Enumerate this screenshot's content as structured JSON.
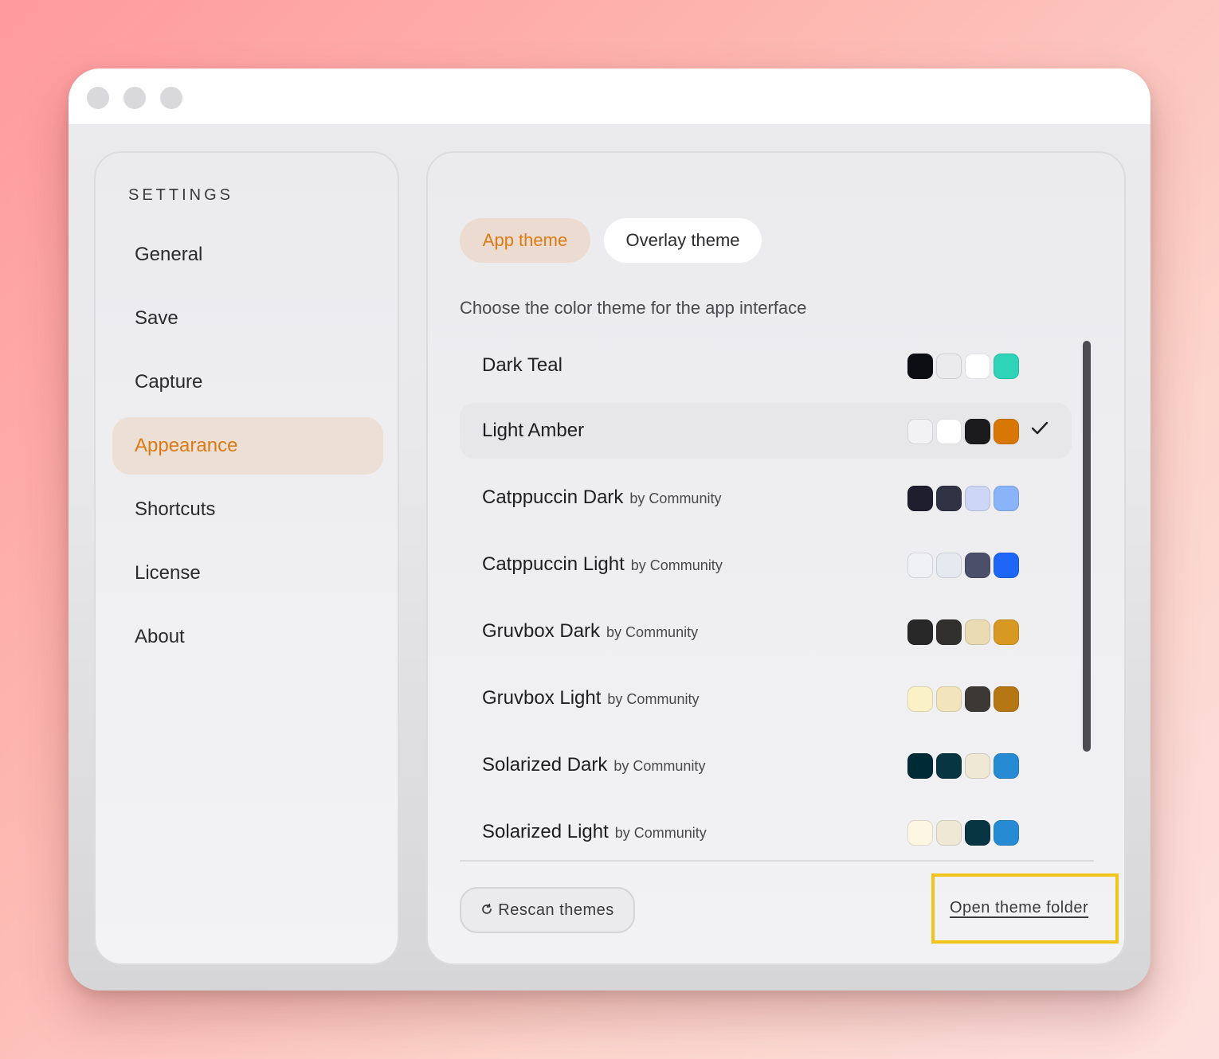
{
  "sidebar": {
    "heading": "SETTINGS",
    "items": [
      {
        "label": "General"
      },
      {
        "label": "Save"
      },
      {
        "label": "Capture"
      },
      {
        "label": "Appearance",
        "active": true
      },
      {
        "label": "Shortcuts"
      },
      {
        "label": "License"
      },
      {
        "label": "About"
      }
    ]
  },
  "main": {
    "tabs": [
      {
        "label": "App theme",
        "active": true
      },
      {
        "label": "Overlay theme"
      }
    ],
    "subtitle": "Choose the color theme for the app interface",
    "themes": [
      {
        "name": "Dark Teal",
        "author": "",
        "swatches": [
          "#0d0d14",
          "#ebebed",
          "#ffffff",
          "#2ed3b8"
        ],
        "selected": false
      },
      {
        "name": "Light Amber",
        "author": "",
        "swatches": [
          "#f2f2f4",
          "#ffffff",
          "#1b1b1d",
          "#d97706"
        ],
        "selected": true
      },
      {
        "name": "Catppuccin Dark",
        "author": "by Community",
        "swatches": [
          "#1e1e2e",
          "#313244",
          "#cdd6f4",
          "#89b4fa"
        ],
        "selected": false
      },
      {
        "name": "Catppuccin Light",
        "author": "by Community",
        "swatches": [
          "#eff1f5",
          "#e6e9ef",
          "#4c4f69",
          "#1e66f5"
        ],
        "selected": false
      },
      {
        "name": "Gruvbox Dark",
        "author": "by Community",
        "swatches": [
          "#282828",
          "#32302f",
          "#ebdbb2",
          "#d79921"
        ],
        "selected": false
      },
      {
        "name": "Gruvbox Light",
        "author": "by Community",
        "swatches": [
          "#fbf1c7",
          "#f2e5bc",
          "#3c3836",
          "#b57614"
        ],
        "selected": false
      },
      {
        "name": "Solarized Dark",
        "author": "by Community",
        "swatches": [
          "#002b36",
          "#073642",
          "#eee8d5",
          "#268bd2"
        ],
        "selected": false
      },
      {
        "name": "Solarized Light",
        "author": "by Community",
        "swatches": [
          "#fdf6e3",
          "#eee8d5",
          "#073642",
          "#268bd2"
        ],
        "selected": false
      }
    ],
    "rescan_label": "Rescan themes",
    "open_folder_label": "Open theme folder"
  },
  "colors": {
    "accent": "#dc7a14",
    "accent_bg": "#ecdfd6",
    "highlight_frame": "#f0c419"
  }
}
